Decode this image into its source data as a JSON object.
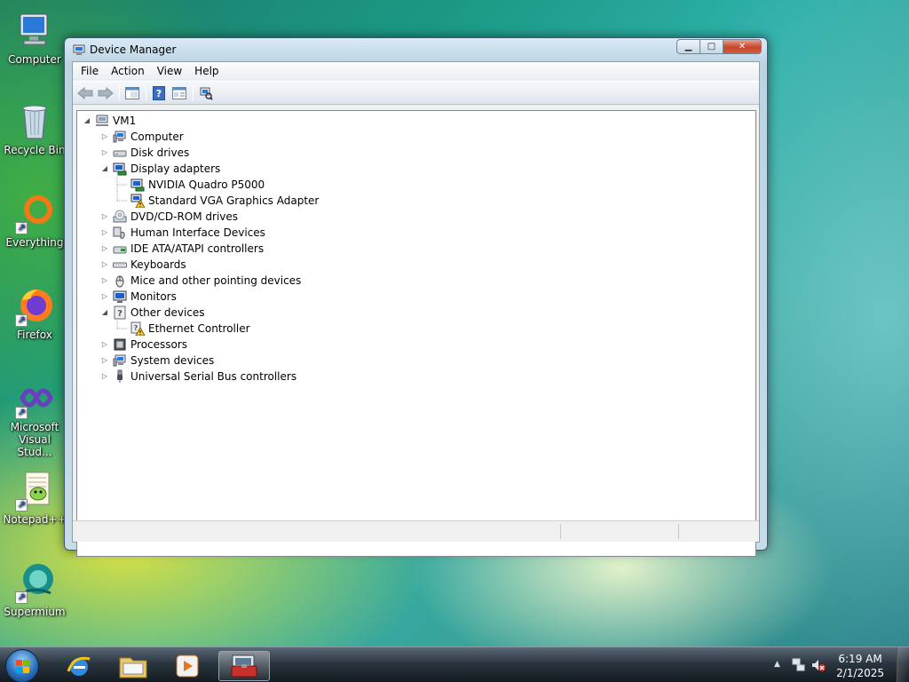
{
  "desktop": {
    "icons": [
      {
        "label": "Computer",
        "icon": "computer-icon"
      },
      {
        "label": "Recycle Bin",
        "icon": "recycle-bin-icon"
      },
      {
        "label": "Everything",
        "icon": "everything-icon"
      },
      {
        "label": "Firefox",
        "icon": "firefox-icon"
      },
      {
        "label": "Microsoft Visual Stud...",
        "icon": "visual-studio-icon"
      },
      {
        "label": "Notepad++",
        "icon": "notepad-plus-plus-icon"
      },
      {
        "label": "Supermium",
        "icon": "supermium-icon"
      }
    ]
  },
  "window": {
    "title": "Device Manager",
    "caption_buttons": {
      "minimize": "▁",
      "maximize": "□",
      "close": "✕"
    },
    "menu": [
      "File",
      "Action",
      "View",
      "Help"
    ],
    "toolbar": [
      "back-arrow-icon",
      "forward-arrow-icon",
      "show-hide-console-tree-icon",
      "help-icon",
      "properties-icon",
      "scan-hardware-icon"
    ],
    "tree": {
      "root": {
        "label": "VM1",
        "expanded": true,
        "icon": "computer-network-icon"
      },
      "items": [
        {
          "label": "Computer",
          "expanded": false,
          "icon": "computer-icon"
        },
        {
          "label": "Disk drives",
          "expanded": false,
          "icon": "disk-drive-icon"
        },
        {
          "label": "Display adapters",
          "expanded": true,
          "icon": "display-adapter-icon",
          "children": [
            {
              "label": "NVIDIA Quadro P5000",
              "icon": "display-adapter-icon",
              "warning": false
            },
            {
              "label": "Standard VGA Graphics Adapter",
              "icon": "display-adapter-icon",
              "warning": true
            }
          ]
        },
        {
          "label": "DVD/CD-ROM drives",
          "expanded": false,
          "icon": "dvd-drive-icon"
        },
        {
          "label": "Human Interface Devices",
          "expanded": false,
          "icon": "hid-icon"
        },
        {
          "label": "IDE ATA/ATAPI controllers",
          "expanded": false,
          "icon": "ide-controller-icon"
        },
        {
          "label": "Keyboards",
          "expanded": false,
          "icon": "keyboard-icon"
        },
        {
          "label": "Mice and other pointing devices",
          "expanded": false,
          "icon": "mouse-icon"
        },
        {
          "label": "Monitors",
          "expanded": false,
          "icon": "monitor-icon"
        },
        {
          "label": "Other devices",
          "expanded": true,
          "icon": "unknown-device-icon",
          "children": [
            {
              "label": "Ethernet Controller",
              "icon": "unknown-device-icon",
              "warning": true
            }
          ]
        },
        {
          "label": "Processors",
          "expanded": false,
          "icon": "processor-icon"
        },
        {
          "label": "System devices",
          "expanded": false,
          "icon": "system-device-icon"
        },
        {
          "label": "Universal Serial Bus controllers",
          "expanded": false,
          "icon": "usb-icon"
        }
      ]
    }
  },
  "taskbar": {
    "pinned": [
      "internet-explorer-icon",
      "windows-explorer-icon",
      "media-player-icon",
      "device-manager-icon"
    ],
    "clock": {
      "time": "6:19 AM",
      "date": "2/1/2025"
    },
    "tray": [
      "show-hidden-icons-icon",
      "network-icon",
      "volume-muted-icon"
    ]
  }
}
